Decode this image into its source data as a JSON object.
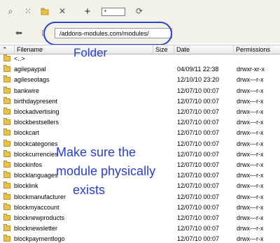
{
  "toolbar": {
    "path_value": "*"
  },
  "address": {
    "value": "/addons-modules.com/modules/"
  },
  "columns": {
    "filename": "Filename",
    "size": "Size",
    "date": "Date",
    "permissions": "Permissions"
  },
  "parent_dir": "<..>",
  "files": [
    {
      "name": "agilepaypal",
      "date": "04/09/11 22:38",
      "perm": "drwxr-xr-x"
    },
    {
      "name": "agileseotags",
      "date": "12/10/10 23:20",
      "perm": "drwx---r-x"
    },
    {
      "name": "bankwire",
      "date": "12/07/10 00:07",
      "perm": "drwx---r-x"
    },
    {
      "name": "birthdaypresent",
      "date": "12/07/10 00:07",
      "perm": "drwx---r-x"
    },
    {
      "name": "blockadvertising",
      "date": "12/07/10 00:07",
      "perm": "drwx---r-x"
    },
    {
      "name": "blockbestsellers",
      "date": "12/07/10 00:07",
      "perm": "drwx---r-x"
    },
    {
      "name": "blockcart",
      "date": "12/07/10 00:07",
      "perm": "drwx---r-x"
    },
    {
      "name": "blockcategories",
      "date": "12/07/10 00:07",
      "perm": "drwx---r-x"
    },
    {
      "name": "blockcurrencies",
      "date": "12/07/10 00:07",
      "perm": "drwx---r-x"
    },
    {
      "name": "blockinfos",
      "date": "12/07/10 00:07",
      "perm": "drwx---r-x"
    },
    {
      "name": "blocklanguages",
      "date": "12/07/10 00:07",
      "perm": "drwx---r-x"
    },
    {
      "name": "blocklink",
      "date": "12/07/10 00:07",
      "perm": "drwx---r-x"
    },
    {
      "name": "blockmanufacturer",
      "date": "12/07/10 00:07",
      "perm": "drwx---r-x"
    },
    {
      "name": "blockmyaccount",
      "date": "12/07/10 00:07",
      "perm": "drwx---r-x"
    },
    {
      "name": "blocknewproducts",
      "date": "12/07/10 00:07",
      "perm": "drwx---r-x"
    },
    {
      "name": "blocknewsletter",
      "date": "12/07/10 00:07",
      "perm": "drwx---r-x"
    },
    {
      "name": "blockpaymentlogo",
      "date": "12/07/10 00:07",
      "perm": "drwx---r-x"
    }
  ],
  "annotations": {
    "folder": "Folder",
    "make_sure_1": "Make sure the",
    "make_sure_2": "module physically",
    "make_sure_3": "exists"
  },
  "icons": [
    "search-icon",
    "sync-icon",
    "new-folder-icon",
    "delete-icon",
    "add-icon",
    "refresh-icon",
    "back-arrow-icon",
    "folder-icon"
  ],
  "colors": {
    "annotation": "#2a3fd0",
    "toolbar_bg": "#f2f1ea",
    "folder": "#e8c34a"
  }
}
